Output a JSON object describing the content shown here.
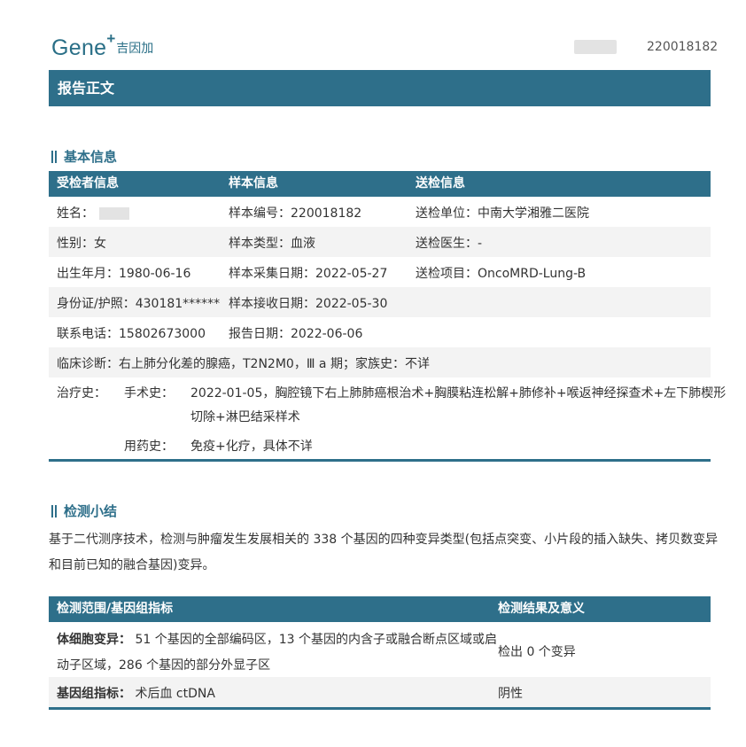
{
  "header": {
    "logo_text": "Gene",
    "logo_plus": "+",
    "logo_cn": "吉因加",
    "report_id": "220018182"
  },
  "banner": {
    "title": "报告正文"
  },
  "basic_info": {
    "section_title": "基本信息",
    "headers": [
      "受检者信息",
      "样本信息",
      "送检信息"
    ],
    "rows": [
      [
        "姓名：",
        "样本编号：220018182",
        "送检单位：中南大学湘雅二医院"
      ],
      [
        "性别：女",
        "样本类型：血液",
        "送检医生：-"
      ],
      [
        "出生年月：1980-06-16",
        "样本采集日期：2022-05-27",
        "送检项目：OncoMRD-Lung-B"
      ],
      [
        "身份证/护照：430181******",
        "样本接收日期：2022-05-30",
        ""
      ],
      [
        "联系电话：15802673000",
        "报告日期：2022-06-06",
        ""
      ]
    ],
    "diagnosis": "临床诊断：右上肺分化差的腺癌，T2N2M0，Ⅲ a 期；家族史：不详",
    "treatment_label": "治疗史：",
    "surgery_label": "手术史：",
    "surgery_line1": "2022-01-05，胸腔镜下右上肺肺癌根治术+胸膜粘连松解+肺修补+喉返神经探查术+左下肺楔形",
    "surgery_line2": "切除+淋巴结采样术",
    "medication_label": "用药史：",
    "medication_value": "免疫+化疗，具体不详"
  },
  "summary": {
    "section_title": "检测小结",
    "line1": "基于二代测序技术，检测与肿瘤发生发展相关的  338 个基因的四种变异类型(包括点突变、小片段的插入缺失、拷贝数变异",
    "line2": "和目前已知的融合基因)变异。",
    "headers": [
      "检测范围/基因组指标",
      "检测结果及意义"
    ],
    "rows": [
      {
        "label": "体细胞变异",
        "sep": "：",
        "line1": " 51 个基因的全部编码区，13 个基因的内含子或融合断点区域或启",
        "line2": "动子区域，286 个基因的部分外显子区",
        "result": "检出 0 个变异"
      },
      {
        "label": "基因组指标",
        "sep": "：",
        "line1": " 术后血 ctDNA",
        "result": "阴性"
      }
    ]
  },
  "colors": {
    "brand": "#2e6f8a",
    "row_alt": "#f3f3f3",
    "text": "#333333"
  }
}
